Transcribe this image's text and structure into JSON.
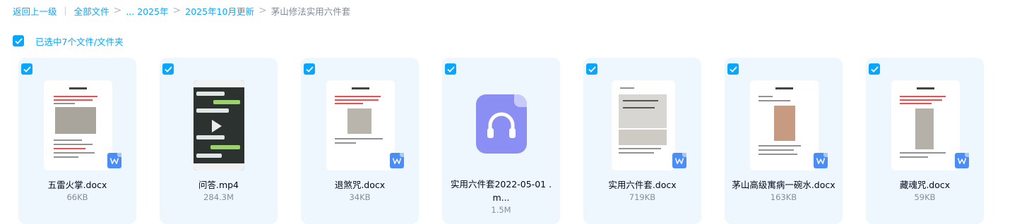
{
  "breadcrumb": {
    "back": "返回上一级",
    "items": [
      "全部文件",
      "... 2025年",
      "2025年10月更新"
    ],
    "current": "茅山修法实用六件套",
    "separator": ">"
  },
  "selection": {
    "label": "已选中7个文件/文件夹",
    "checked": true
  },
  "colors": {
    "accent": "#06a7ff",
    "card_bg": "#eef7fe",
    "word_icon": "#4a8df6",
    "audio_icon": "#8b8ff3"
  },
  "files": [
    {
      "name": "五雷火掌.docx",
      "size": "66KB",
      "type": "docx",
      "icon": "word-icon",
      "selected": true
    },
    {
      "name": "问答.mp4",
      "size": "284.3M",
      "type": "video",
      "icon": "play-icon",
      "selected": true
    },
    {
      "name": "退煞咒.docx",
      "size": "34KB",
      "type": "docx",
      "icon": "word-icon",
      "selected": true
    },
    {
      "name_line1": "实用六件套2022-05-01 .",
      "name_line2": "m...",
      "size": "1.5M",
      "type": "audio",
      "icon": "headphones-icon",
      "selected": true
    },
    {
      "name": "实用六件套.docx",
      "size": "719KB",
      "type": "docx",
      "icon": "word-icon",
      "selected": true
    },
    {
      "name": "茅山高级寓病一碗水.docx",
      "size": "163KB",
      "type": "docx",
      "icon": "word-icon",
      "selected": true
    },
    {
      "name": "藏魂咒.docx",
      "size": "59KB",
      "type": "docx",
      "icon": "word-icon",
      "selected": true
    }
  ]
}
